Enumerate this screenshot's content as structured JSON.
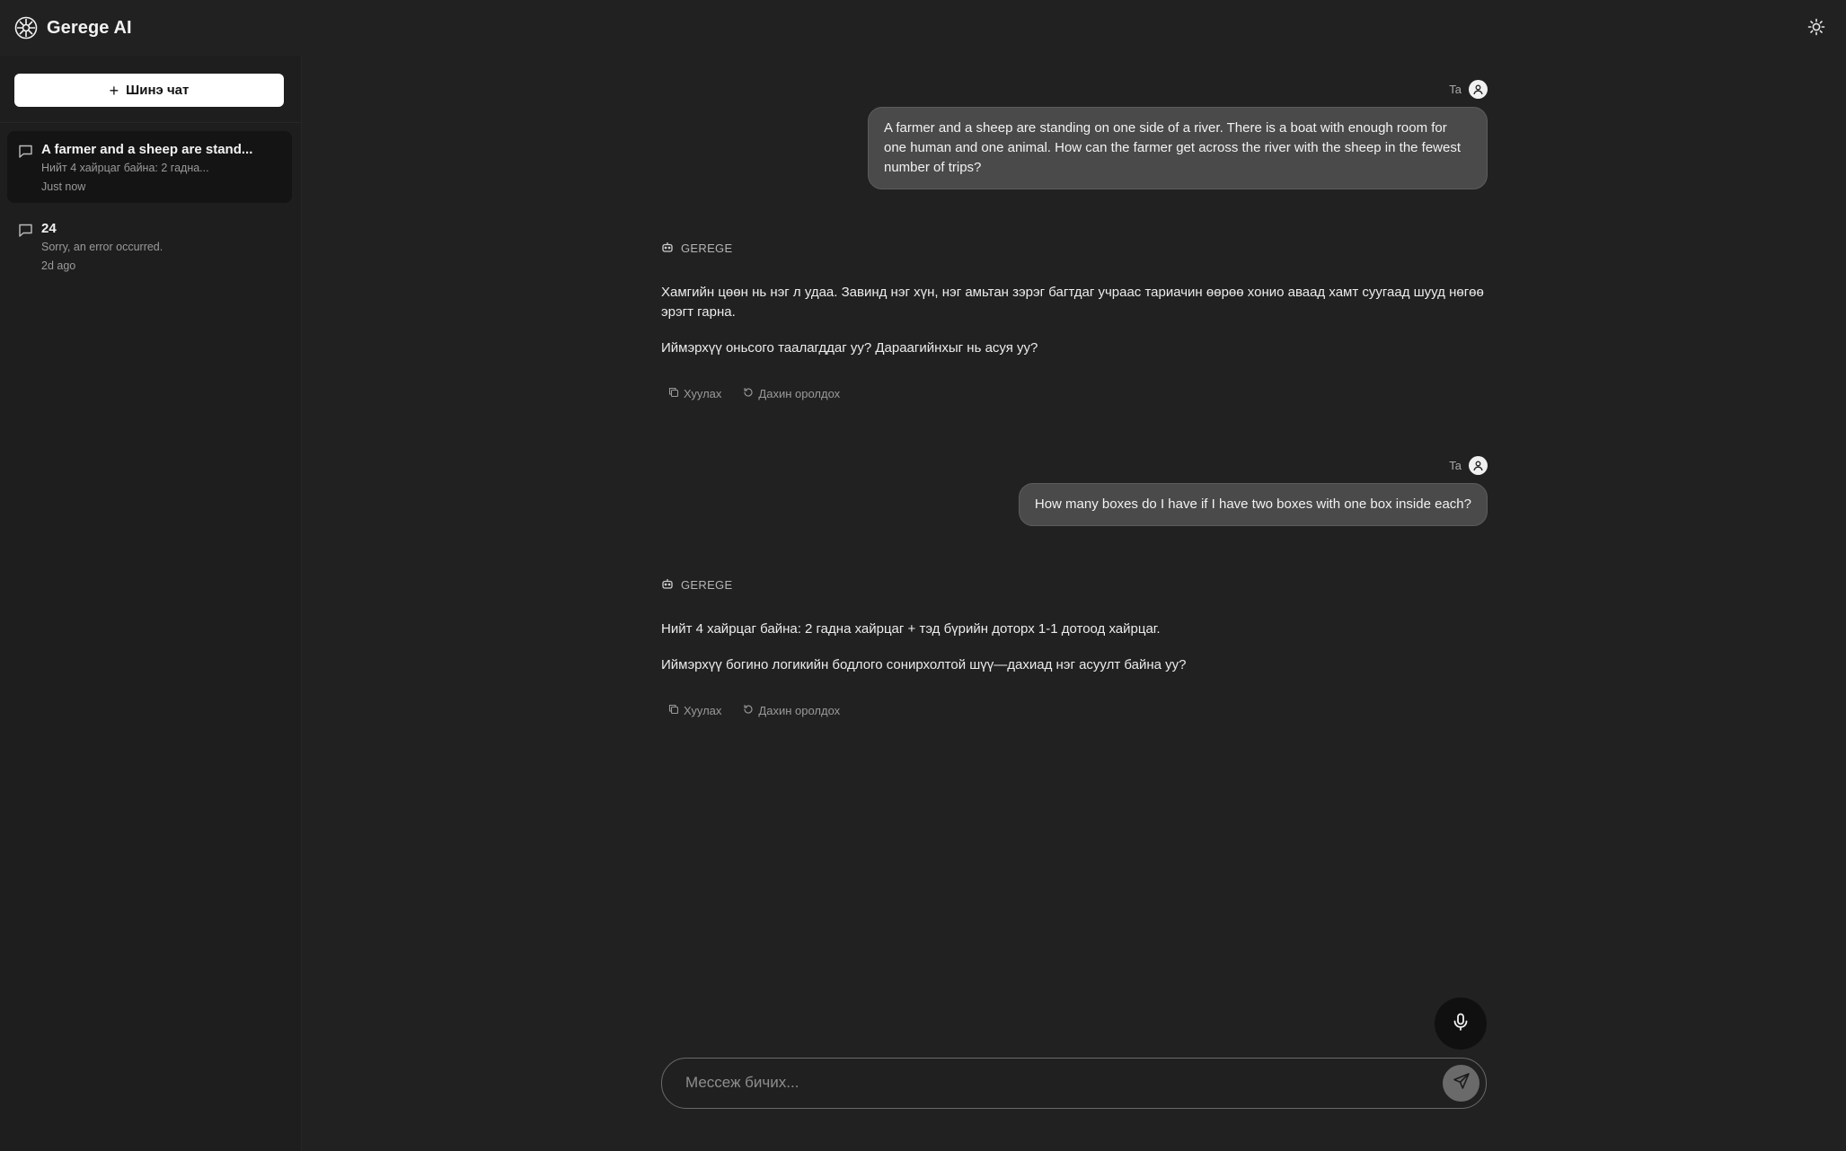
{
  "app": {
    "title": "Gerege AI"
  },
  "sidebar": {
    "new_chat_label": "Шинэ чат",
    "chats": [
      {
        "title": "A farmer and a sheep are stand...",
        "preview": "Нийт 4 хайрцаг байна: 2 гадна...",
        "time": "Just now",
        "active": true
      },
      {
        "title": "24",
        "preview": "Sorry, an error occurred.",
        "time": "2d ago",
        "active": false
      }
    ]
  },
  "conversation": {
    "user_label": "Ta",
    "assistant_label": "GEREGE",
    "messages": [
      {
        "role": "user",
        "text": "A farmer and a sheep are standing on one side of a river. There is a boat with enough room for one human and one animal. How can the farmer get across the river with the sheep in the fewest number of trips?"
      },
      {
        "role": "assistant",
        "paragraphs": [
          "Хамгийн цөөн нь нэг л удаа. Завинд нэг хүн, нэг амьтан зэрэг багтдаг учраас тариачин өөрөө хонио аваад хамт суугаад шууд нөгөө эрэгт гарна.",
          "Иймэрхүү оньсого таалагддаг уу? Дараагийнхыг нь асуя уу?"
        ]
      },
      {
        "role": "user",
        "text": "How many boxes do I have if I have two boxes with one box inside each?"
      },
      {
        "role": "assistant",
        "paragraphs": [
          "Нийт 4 хайрцаг байна: 2 гадна хайрцаг + тэд бүрийн доторх 1-1 дотоод хайрцаг.",
          "Иймэрхүү богино логикийн бодлого сонирхолтой шүү—дахиад нэг асуулт байна уу?"
        ]
      }
    ],
    "actions": {
      "copy": "Хуулах",
      "retry": "Дахин оролдох"
    }
  },
  "composer": {
    "placeholder": "Мессеж бичих..."
  },
  "icons": {
    "logo": "gerege-logo-icon",
    "theme": "sun-icon",
    "chat": "chat-bubble-icon",
    "user": "user-icon",
    "bot": "bot-icon",
    "copy": "copy-icon",
    "retry": "refresh-icon",
    "mic": "microphone-icon",
    "send": "send-icon"
  },
  "colors": {
    "background": "#212121",
    "sidebar": "#1e1e1e",
    "user_bubble": "#4a4a4a",
    "accent": "#ffffff"
  }
}
